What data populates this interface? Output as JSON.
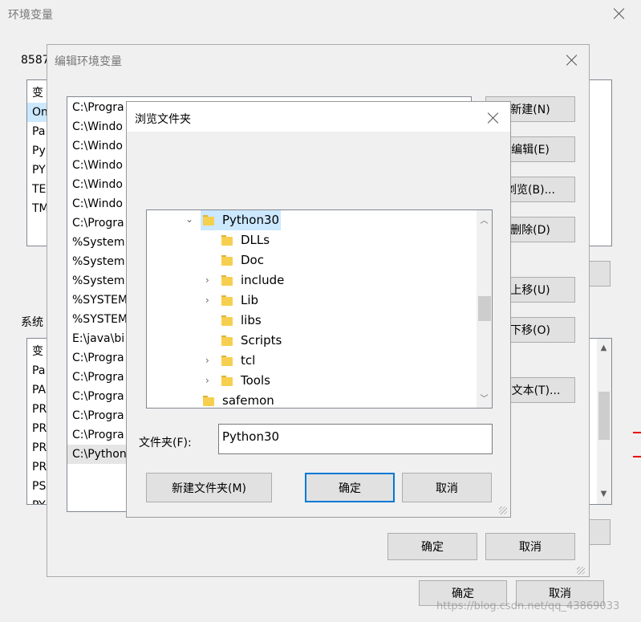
{
  "env_window": {
    "title": "环境变量",
    "user_section_label": "8587",
    "user_vars": [
      "变",
      "On",
      "Pa",
      "Py",
      "PY",
      "TE",
      "TM"
    ],
    "system_section_label": "系统",
    "system_vars": [
      "变",
      "Pa",
      "PA",
      "PR",
      "PR",
      "PR",
      "PR",
      "PS",
      "PY"
    ],
    "ok_label": "确定",
    "cancel_label": "取消"
  },
  "edit_window": {
    "title": "编辑环境变量",
    "paths": [
      "C:\\Progra",
      "C:\\Windo",
      "C:\\Windo",
      "C:\\Windo",
      "C:\\Windo",
      "C:\\Windo",
      "C:\\Progra",
      "%System",
      "%System",
      "%System",
      "%SYSTEM",
      "%SYSTEM",
      "E:\\java\\bi",
      "C:\\Progra",
      "C:\\Progra",
      "C:\\Progra",
      "C:\\Progra",
      "C:\\Progra",
      "C:\\Python"
    ],
    "btn_new": "新建(N)",
    "btn_edit": "编辑(E)",
    "btn_browse": "浏览(B)...",
    "btn_delete": "删除(D)",
    "btn_up": "上移(U)",
    "btn_down": "下移(O)",
    "btn_edit_text": "辑文本(T)...",
    "ok_label": "确定",
    "cancel_label": "取消"
  },
  "browse_dialog": {
    "title": "浏览文件夹",
    "tree": [
      {
        "name": "Python30",
        "expanded": true,
        "selected": true
      },
      {
        "name": "DLLs"
      },
      {
        "name": "Doc"
      },
      {
        "name": "include",
        "expandable": true
      },
      {
        "name": "Lib",
        "expandable": true
      },
      {
        "name": "libs"
      },
      {
        "name": "Scripts"
      },
      {
        "name": "tcl",
        "expandable": true
      },
      {
        "name": "Tools",
        "expandable": true
      },
      {
        "name": "safemon"
      }
    ],
    "folder_label": "文件夹(F):",
    "folder_value": "Python30",
    "new_folder_label": "新建文件夹(M)",
    "ok_label": "确定",
    "cancel_label": "取消"
  },
  "watermark": "https://blog.csdn.net/qq_43869033",
  "colors": {
    "selection": "#cce8ff",
    "accent": "#0078d7",
    "folder": "#f7cf4f"
  }
}
